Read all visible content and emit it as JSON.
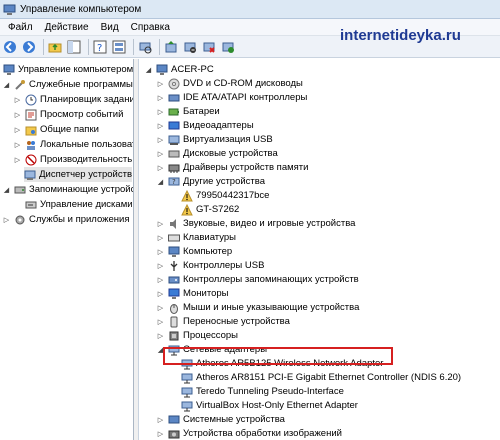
{
  "window": {
    "title": "Управление компьютером"
  },
  "menu": [
    "Файл",
    "Действие",
    "Вид",
    "Справка"
  ],
  "watermark": "internetideyka.ru",
  "left_tree": [
    {
      "label": "Управление компьютером (л",
      "icon": "computer-management-icon"
    },
    {
      "label": "Служебные программы",
      "icon": "tools-icon"
    },
    {
      "label": "Планировщик заданий",
      "icon": "clock-icon"
    },
    {
      "label": "Просмотр событий",
      "icon": "event-viewer-icon"
    },
    {
      "label": "Общие папки",
      "icon": "shared-folder-icon"
    },
    {
      "label": "Локальные пользовате",
      "icon": "users-icon"
    },
    {
      "label": "Производительность",
      "icon": "performance-icon"
    },
    {
      "label": "Диспетчер устройств",
      "icon": "device-manager-icon"
    },
    {
      "label": "Запоминающие устройств",
      "icon": "storage-icon"
    },
    {
      "label": "Управление дисками",
      "icon": "disk-icon"
    },
    {
      "label": "Службы и приложения",
      "icon": "services-icon"
    }
  ],
  "device_tree": {
    "root": "ACER-PC",
    "items": [
      "DVD и CD-ROM дисководы",
      "IDE ATA/ATAPI контроллеры",
      "Батареи",
      "Видеоадаптеры",
      "Виртуализация USB",
      "Дисковые устройства",
      "Драйверы устройств памяти",
      "Другие устройства",
      "79950442317bce",
      "GT-S7262",
      "Звуковые, видео и игровые устройства",
      "Клавиатуры",
      "Компьютер",
      "Контроллеры USB",
      "Контроллеры запоминающих устройств",
      "Мониторы",
      "Мыши и иные указывающие устройства",
      "Переносные устройства",
      "Процессоры",
      "Сетевые адаптеры",
      "Atheros AR5B125 Wireless Network Adapter",
      "Atheros AR8151 PCI-E Gigabit Ethernet Controller (NDIS 6.20)",
      "Teredo Tunneling Pseudo-Interface",
      "VirtualBox Host-Only Ethernet Adapter",
      "Системные устройства",
      "Устройства обработки изображений"
    ]
  },
  "colors": {
    "highlight": "#d62020",
    "watermark": "#1f3a93"
  }
}
